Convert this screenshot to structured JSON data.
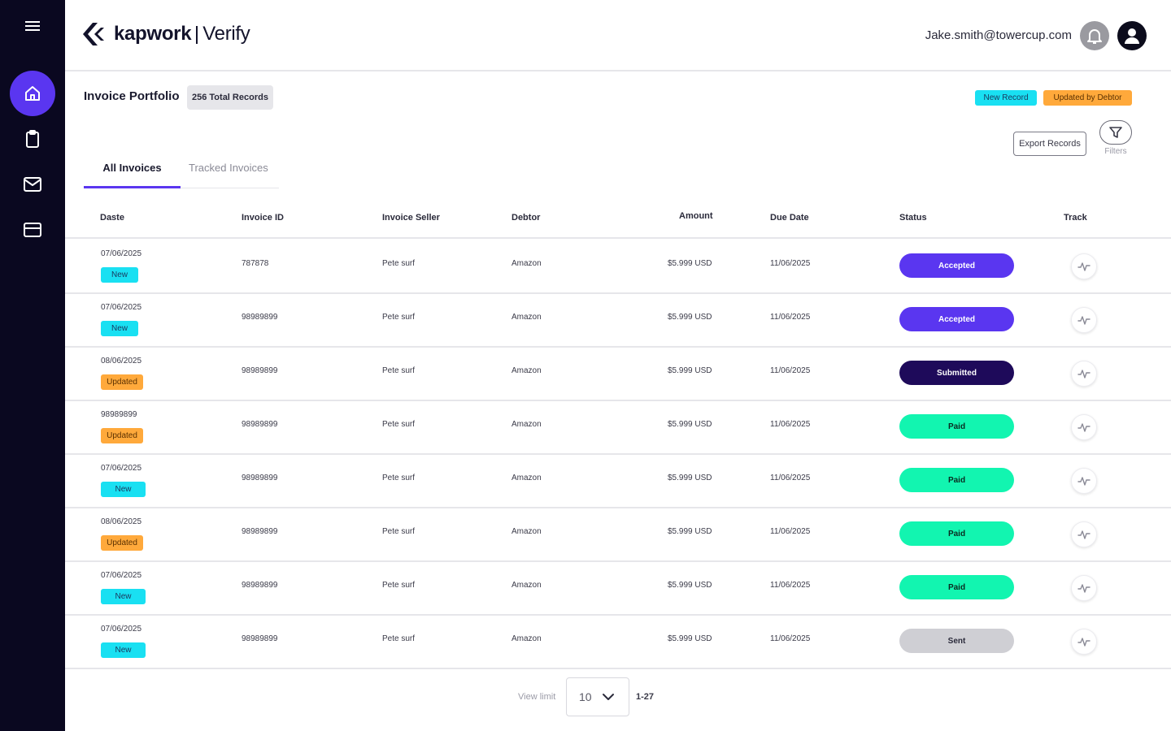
{
  "app": {
    "brand": "kapwork",
    "product": "Verify"
  },
  "header": {
    "user_email": "Jake.smith@towercup.com"
  },
  "sidebar": {
    "items": [
      {
        "icon": "home-icon",
        "active": true
      },
      {
        "icon": "clipboard-icon",
        "active": false
      },
      {
        "icon": "mail-icon",
        "active": false
      },
      {
        "icon": "card-icon",
        "active": false
      }
    ]
  },
  "portfolio": {
    "title": "Invoice Portfolio",
    "total_records": "256 Total Records",
    "legend_new": "New Record",
    "legend_updated": "Updated by Debtor",
    "export_label": "Export Records",
    "filters_label": "Filters"
  },
  "tabs": [
    {
      "label": "All Invoices",
      "active": true
    },
    {
      "label": "Tracked Invoices",
      "active": false
    }
  ],
  "table": {
    "columns": [
      "Daste",
      "Invoice ID",
      "Invoice Seller",
      "Debtor",
      "Amount",
      "Due Date",
      "Status",
      "Track"
    ],
    "rows": [
      {
        "date": "07/06/2025",
        "tag": "New",
        "tag_type": "new",
        "id": "787878",
        "seller": "Pete surf",
        "debtor": "Amazon",
        "amount": "$5.999 USD",
        "due": "11/06/2025",
        "status": "Accepted",
        "status_type": "accepted"
      },
      {
        "date": "07/06/2025",
        "tag": "New",
        "tag_type": "new",
        "id": "98989899",
        "seller": "Pete surf",
        "debtor": "Amazon",
        "amount": "$5.999 USD",
        "due": "11/06/2025",
        "status": "Accepted",
        "status_type": "accepted"
      },
      {
        "date": "08/06/2025",
        "tag": "Updated",
        "tag_type": "updated",
        "id": "98989899",
        "seller": "Pete surf",
        "debtor": "Amazon",
        "amount": "$5.999 USD",
        "due": "11/06/2025",
        "status": "Submitted",
        "status_type": "submitted"
      },
      {
        "date": "98989899",
        "tag": "Updated",
        "tag_type": "updated",
        "id": "98989899",
        "seller": "Pete surf",
        "debtor": "Amazon",
        "amount": "$5.999 USD",
        "due": "11/06/2025",
        "status": "Paid",
        "status_type": "paid"
      },
      {
        "date": "07/06/2025",
        "tag": "New",
        "tag_type": "new",
        "id": "98989899",
        "seller": "Pete surf",
        "debtor": "Amazon",
        "amount": "$5.999 USD",
        "due": "11/06/2025",
        "status": "Paid",
        "status_type": "paid"
      },
      {
        "date": "08/06/2025",
        "tag": "Updated",
        "tag_type": "updated",
        "id": "98989899",
        "seller": "Pete surf",
        "debtor": "Amazon",
        "amount": "$5.999 USD",
        "due": "11/06/2025",
        "status": "Paid",
        "status_type": "paid"
      },
      {
        "date": "07/06/2025",
        "tag": "New",
        "tag_type": "new",
        "id": "98989899",
        "seller": "Pete surf",
        "debtor": "Amazon",
        "amount": "$5.999 USD",
        "due": "11/06/2025",
        "status": "Paid",
        "status_type": "paid"
      },
      {
        "date": "07/06/2025",
        "tag": "New",
        "tag_type": "new",
        "id": "98989899",
        "seller": "Pete surf",
        "debtor": "Amazon",
        "amount": "$5.999 USD",
        "due": "11/06/2025",
        "status": "Sent",
        "status_type": "sent"
      }
    ]
  },
  "pagination": {
    "view_limit_label": "View limit",
    "limit_value": "10",
    "range": "1-27"
  },
  "colors": {
    "sidebar_bg": "#0a0820",
    "accent": "#5a36f0",
    "new_tag": "#19e0f2",
    "updated_tag": "#ffa93b",
    "paid": "#12f5b0",
    "submitted": "#1e0a5a",
    "sent": "#cfcfd4"
  }
}
